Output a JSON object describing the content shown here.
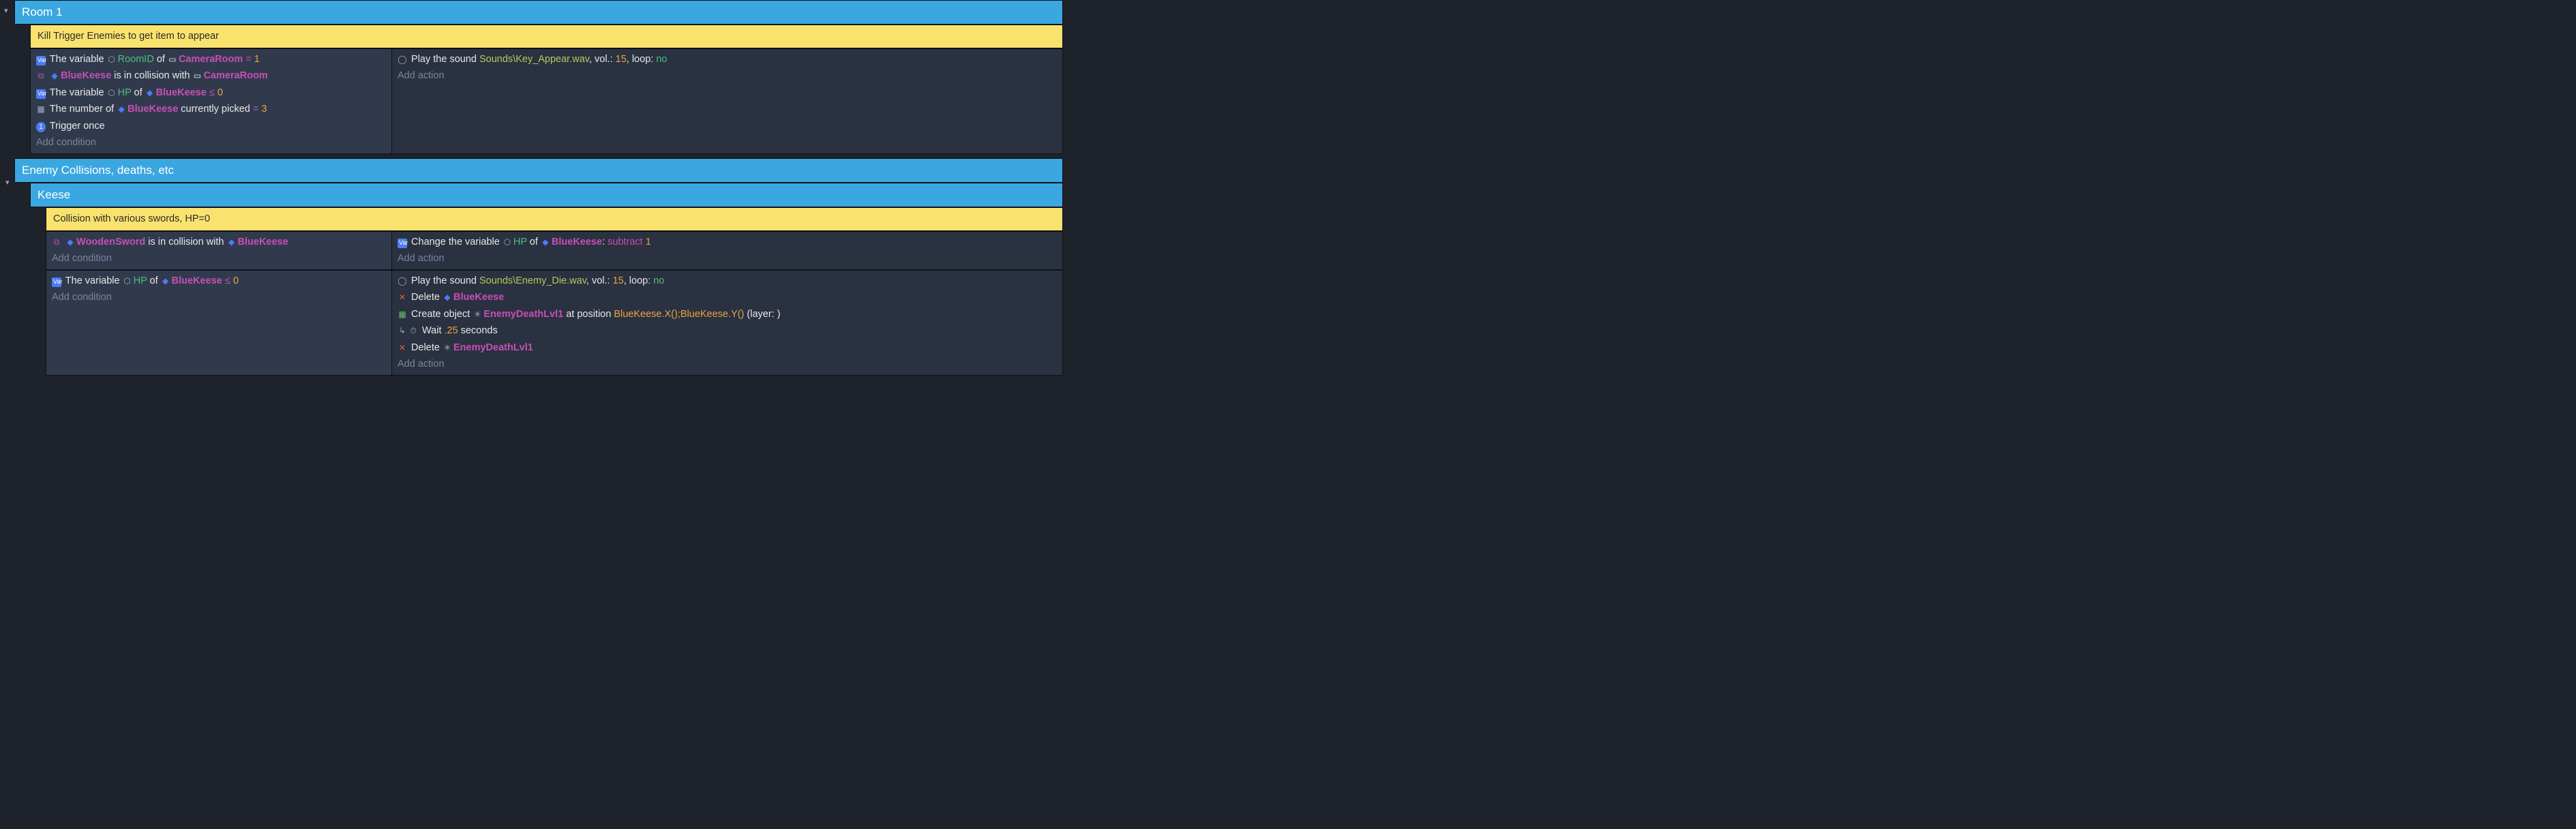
{
  "groups": {
    "room1": "Room 1",
    "enemy": "Enemy Collisions, deaths, etc",
    "keese": "Keese"
  },
  "comments": {
    "killTrigger": "Kill Trigger Enemies to get item to appear",
    "swordHP": "Collision with various swords, HP=0"
  },
  "evt1": {
    "cond": [
      {
        "pre": "The variable ",
        "icon": "varicon",
        "var": "RoomID",
        "mid": " of ",
        "objIcon": "sprite2",
        "obj": "CameraRoom",
        "op": " = ",
        "val": "1"
      },
      {
        "icon": "sprite",
        "obj": "BlueKeese",
        "mid": " is in collision with ",
        "objIcon2": "sprite2",
        "obj2": "CameraRoom"
      },
      {
        "pre": "The variable ",
        "icon": "varicon",
        "var": "HP",
        "mid": " of ",
        "objIcon": "sprite",
        "obj": "BlueKeese",
        "op": " ≤ ",
        "val": "0"
      },
      {
        "pickPre": "The number of ",
        "objIcon": "sprite",
        "obj": "BlueKeese",
        "pickMid": " currently picked ",
        "op": " = ",
        "val": "3"
      },
      {
        "trigger": "Trigger once"
      }
    ],
    "addCond": "Add condition",
    "act": [
      {
        "soundPre": "Play the sound ",
        "path": "Sounds\\Key_Appear.wav",
        "volPre": ", vol.: ",
        "vol": "15",
        "loopPre": ", loop: ",
        "loop": "no"
      }
    ],
    "addAct": "Add action"
  },
  "evt2": {
    "cond": [
      {
        "icon": "sprite",
        "obj": "WoodenSword",
        "mid": " is in collision with ",
        "objIcon2": "sprite",
        "obj2": "BlueKeese"
      }
    ],
    "addCond": "Add condition",
    "act": [
      {
        "chgPre": "Change the variable ",
        "icon": "varicon",
        "var": "HP",
        "mid": " of ",
        "objIcon": "sprite",
        "obj": "BlueKeese",
        "colon": ": ",
        "op": "subtract",
        "sp": " ",
        "val": "1"
      }
    ],
    "addAct": "Add action"
  },
  "evt3": {
    "cond": [
      {
        "pre": "The variable ",
        "icon": "varicon",
        "var": "HP",
        "mid": " of ",
        "objIcon": "sprite",
        "obj": "BlueKeese",
        "op": " ≤ ",
        "val": "0"
      }
    ],
    "addCond": "Add condition",
    "act": [
      {
        "soundPre": "Play the sound ",
        "path": "Sounds\\Enemy_Die.wav",
        "volPre": ", vol.: ",
        "vol": "15",
        "loopPre": ", loop: ",
        "loop": "no"
      },
      {
        "delPre": "Delete ",
        "objIcon": "sprite",
        "obj": "BlueKeese"
      },
      {
        "createPre": "Create object ",
        "objIcon": "sprite3",
        "obj": "EnemyDeathLvl1",
        "posPre": " at position ",
        "pos": "BlueKeese.X();BlueKeese.Y()",
        "layerPre": " (layer: ",
        "layer": "",
        "layerPost": ")"
      },
      {
        "waitPre": "Wait ",
        "waitVal": ".25",
        "waitPost": " seconds"
      },
      {
        "delPre": "Delete ",
        "objIcon": "sprite3",
        "obj": "EnemyDeathLvl1"
      }
    ],
    "addAct": "Add action"
  }
}
